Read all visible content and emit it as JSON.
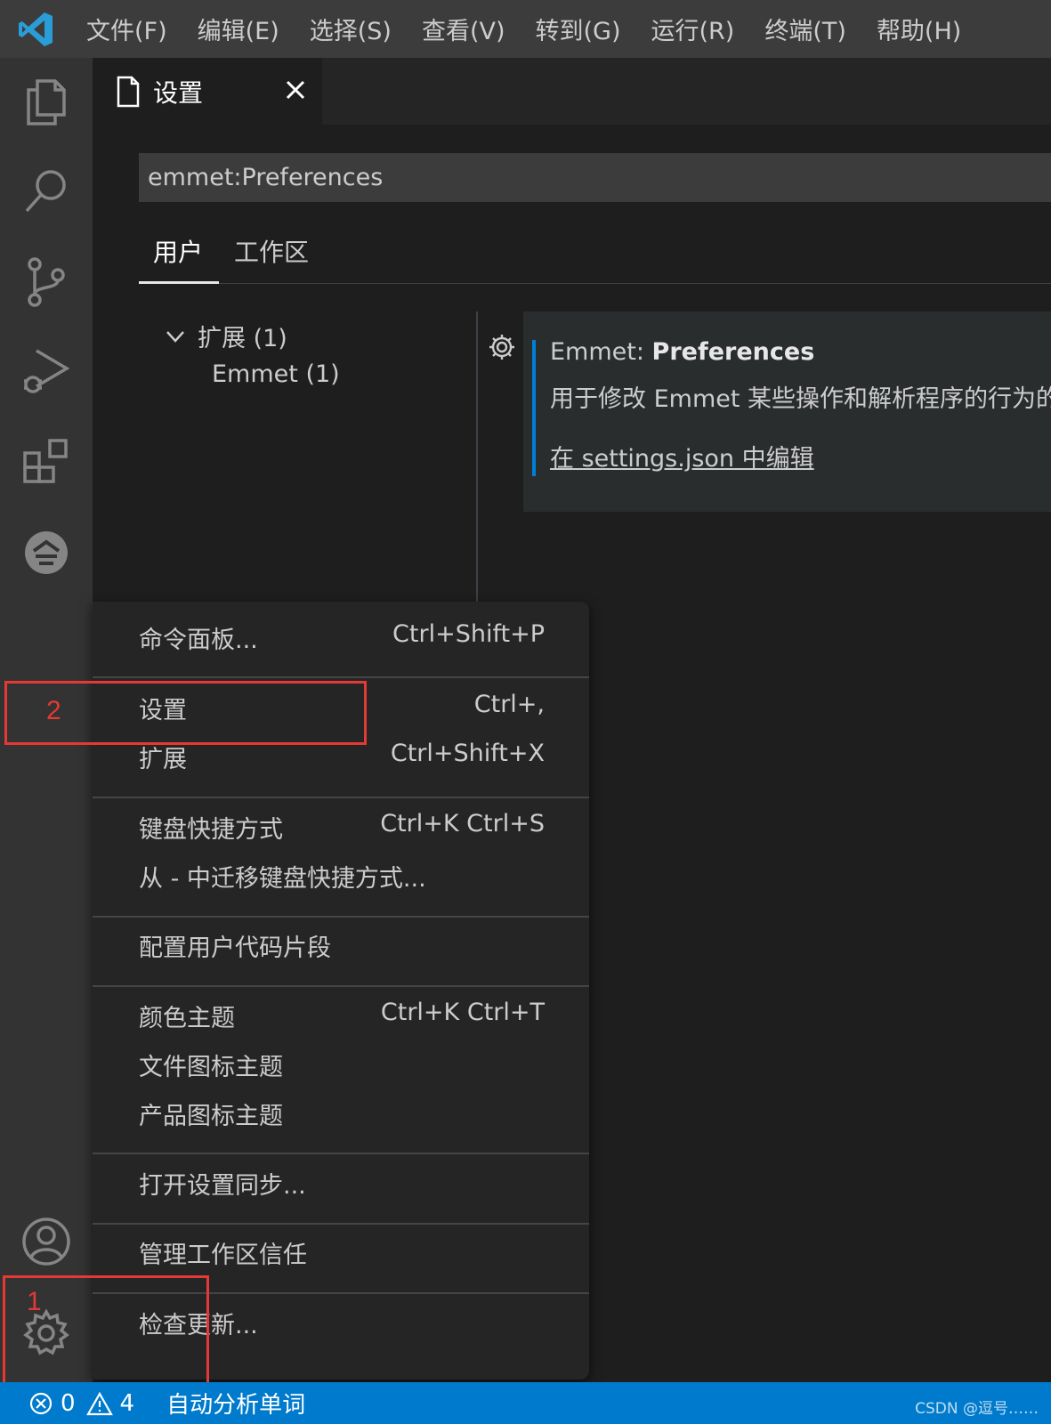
{
  "menubar": {
    "items": [
      "文件(F)",
      "编辑(E)",
      "选择(S)",
      "查看(V)",
      "转到(G)",
      "运行(R)",
      "终端(T)",
      "帮助(H)"
    ]
  },
  "tab": {
    "label": "设置"
  },
  "search": {
    "value": "emmet:Preferences"
  },
  "scopes": {
    "user": "用户",
    "workspace": "工作区"
  },
  "toc": {
    "extensions": "扩展 (1)",
    "emmet": "Emmet (1)"
  },
  "setting": {
    "title_prefix": "Emmet: ",
    "title_name": "Preferences",
    "description": "用于修改 Emmet 某些操作和解析程序的行为的首选项",
    "edit_link": "在 settings.json 中编辑"
  },
  "context_menu": {
    "items": [
      {
        "label": "命令面板...",
        "shortcut": "Ctrl+Shift+P"
      },
      {
        "label": "设置",
        "shortcut": "Ctrl+,"
      },
      {
        "label": "扩展",
        "shortcut": "Ctrl+Shift+X"
      },
      {
        "label": "键盘快捷方式",
        "shortcut": "Ctrl+K Ctrl+S"
      },
      {
        "label": "从 - 中迁移键盘快捷方式...",
        "shortcut": ""
      },
      {
        "label": "配置用户代码片段",
        "shortcut": ""
      },
      {
        "label": "颜色主题",
        "shortcut": "Ctrl+K Ctrl+T"
      },
      {
        "label": "文件图标主题",
        "shortcut": ""
      },
      {
        "label": "产品图标主题",
        "shortcut": ""
      },
      {
        "label": "打开设置同步...",
        "shortcut": ""
      },
      {
        "label": "管理工作区信任",
        "shortcut": ""
      },
      {
        "label": "检查更新...",
        "shortcut": ""
      }
    ]
  },
  "annotations": {
    "one": "1",
    "two": "2"
  },
  "statusbar": {
    "errors": "0",
    "warnings": "4",
    "extension_text": "自动分析单词",
    "watermark": "CSDN @逗号……"
  },
  "colors": {
    "accent": "#007acc",
    "menubar": "#3c3c3c",
    "activitybar": "#333333",
    "editor": "#1e1e1e",
    "annotation": "#e53935"
  },
  "icons": {
    "logo": "vscode-logo-icon",
    "explorer": "files-icon",
    "search": "search-icon",
    "scm": "source-control-icon",
    "debug": "run-debug-icon",
    "extensions": "extensions-icon",
    "remote": "remote-explorer-icon",
    "account": "account-icon",
    "manage": "gear-icon"
  }
}
